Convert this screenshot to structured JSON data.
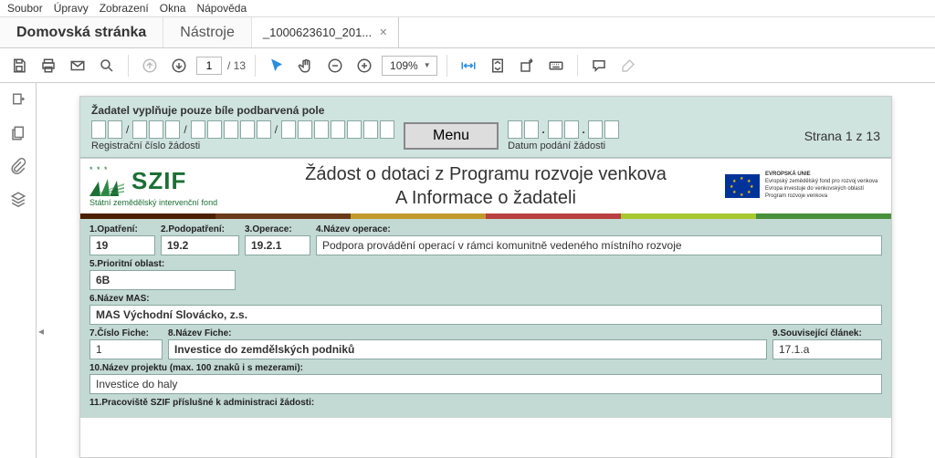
{
  "menubar": [
    "Soubor",
    "Úpravy",
    "Zobrazení",
    "Okna",
    "Nápověda"
  ],
  "tabs": {
    "home": "Domovská stránka",
    "tools": "Nástroje",
    "doc": "_1000623610_201..."
  },
  "toolbar": {
    "page_current": "1",
    "page_total": "/ 13",
    "zoom": "109%"
  },
  "form": {
    "topnote": "Žadatel vyplňuje pouze bíle podbarvená pole",
    "reg_label": "Registrační číslo žádosti",
    "menu_btn": "Menu",
    "datum_label": "Datum podání žádosti",
    "strana": "Strana 1 z 13",
    "szif_big": "SZIF",
    "szif_sub": "Státní zemědělský intervenční fond",
    "title1": "Žádost o dotaci z Programu rozvoje venkova",
    "title2": "A Informace o žadateli",
    "eu_l1": "EVROPSKÁ UNIE",
    "eu_l2": "Evropský zemědělský fond pro rozvoj venkova",
    "eu_l3": "Evropa investuje do venkovských oblastí",
    "eu_l4": "Program rozvoje venkova",
    "f1_lbl": "1.Opatření:",
    "f1_val": "19",
    "f2_lbl": "2.Podopatření:",
    "f2_val": "19.2",
    "f3_lbl": "3.Operace:",
    "f3_val": "19.2.1",
    "f4_lbl": "4.Název operace:",
    "f4_val": "Podpora provádění operací v rámci komunitně vedeného místního rozvoje",
    "f5_lbl": "5.Prioritní oblast:",
    "f5_val": "6B",
    "f6_lbl": "6.Název MAS:",
    "f6_val": "MAS Východní Slovácko, z.s.",
    "f7_lbl": "7.Číslo Fiche:",
    "f7_val": "1",
    "f8_lbl": "8.Název Fiche:",
    "f8_val": "Investice do zemdělských podniků",
    "f9_lbl": "9.Související článek:",
    "f9_val": "17.1.a",
    "f10_lbl": "10.Název projektu (max. 100 znaků i s mezerami):",
    "f10_val": "Investice do haly",
    "f11_lbl": "11.Pracoviště SZIF příslušné k administraci žádosti:"
  }
}
